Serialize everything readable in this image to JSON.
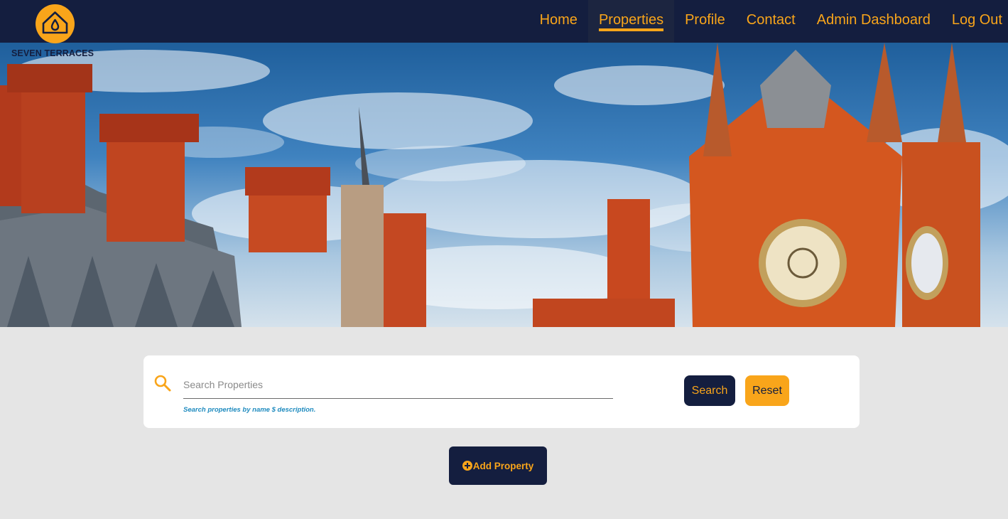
{
  "brand": {
    "name": "SEVEN TERRACES",
    "logo_icon": "house-drop-icon"
  },
  "nav": {
    "items": [
      {
        "label": "Home",
        "active": false
      },
      {
        "label": "Properties",
        "active": true
      },
      {
        "label": "Profile",
        "active": false
      },
      {
        "label": "Contact",
        "active": false
      },
      {
        "label": "Admin Dashboard",
        "active": false
      },
      {
        "label": "Log Out",
        "active": false
      }
    ]
  },
  "search": {
    "placeholder": "Search Properties",
    "value": "",
    "hint": "Search properties by name $ description.",
    "search_label": "Search",
    "reset_label": "Reset",
    "icon": "search-icon"
  },
  "actions": {
    "add_property_label": "Add Property",
    "add_icon": "plus-circle-icon"
  },
  "colors": {
    "navy": "#141e3f",
    "accent": "#f9a51a",
    "background": "#e5e5e5",
    "hint": "#1f8bbf"
  }
}
